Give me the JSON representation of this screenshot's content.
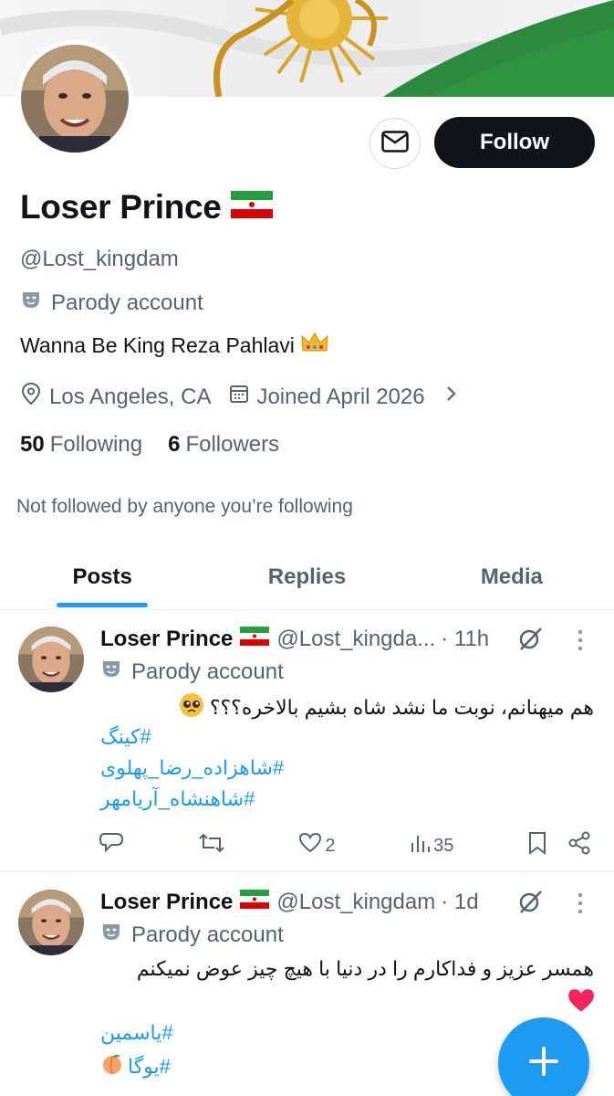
{
  "profile": {
    "name": "Loser Prince",
    "name_flag": "iran-flag-emoji",
    "handle": "@Lost_kingdam",
    "parody_label": "Parody account",
    "bio": "Wanna Be King Reza Pahlavi",
    "bio_emoji": "crown-emoji",
    "location": "Los Angeles, CA",
    "joined": "Joined April 2026",
    "following_count": "50",
    "following_label": "Following",
    "followers_count": "6",
    "followers_label": "Followers",
    "not_followed_text": "Not followed by anyone you’re following"
  },
  "buttons": {
    "follow_label": "Follow",
    "message_icon": "mail-icon"
  },
  "tabs": [
    {
      "label": "Posts",
      "active": true
    },
    {
      "label": "Replies",
      "active": false
    },
    {
      "label": "Media",
      "active": false
    }
  ],
  "posts": [
    {
      "name": "Loser Prince",
      "handle": "@Lost_kingda...",
      "time": "· 11h",
      "parody": "Parody account",
      "text": "هم میهنانم، نوبت ما نشد شاه بشیم بالاخره؟؟؟",
      "tags": [
        "#کینگ",
        "#شاهزاده_رضا_پهلوی",
        "#شاهنشاه_آریامهر"
      ],
      "likes": "2",
      "views": "35"
    },
    {
      "name": "Loser Prince",
      "handle": "@Lost_kingdam",
      "time": "· 1d",
      "parody": "Parody account",
      "text": "همسر عزیز و فداکارم را در دنیا با هیچ چیز عوض نمیکنم",
      "tags": [
        "#یاسمین",
        "#یوگا"
      ]
    }
  ],
  "colors": {
    "accent": "#1d9bf0",
    "text_primary": "#0f1419",
    "text_secondary": "#536471",
    "follow_bg": "#0f1419"
  }
}
